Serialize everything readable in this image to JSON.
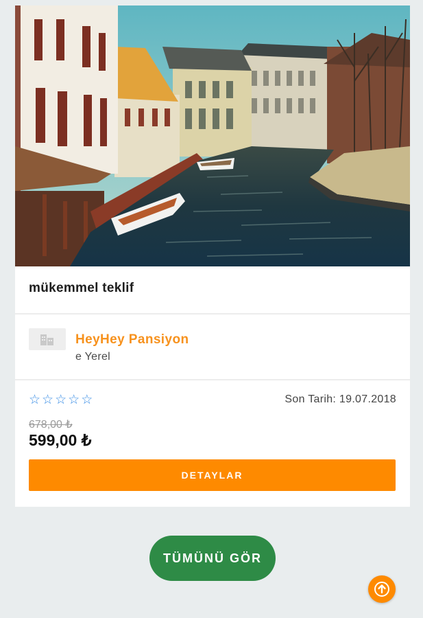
{
  "deal": {
    "title": "mükemmel teklif",
    "hotel_name": "HeyHey Pansiyon",
    "hotel_location": "e Yerel",
    "rating": 0,
    "rating_max": 5,
    "deadline": "Son Tarih: 19.07.2018",
    "old_price": "678,00 ₺",
    "new_price": "599,00 ₺",
    "details_label": "DETAYLAR",
    "image_icon": "canal-photo"
  },
  "actions": {
    "see_all_label": "TÜMÜNÜ GÖR",
    "scroll_top_icon": "arrow-up-icon"
  },
  "colors": {
    "accent": "#fe8a00",
    "hotel_name": "#f7921e",
    "see_all": "#2e8b46",
    "star": "#3a8ee6",
    "background": "#e9edee"
  }
}
